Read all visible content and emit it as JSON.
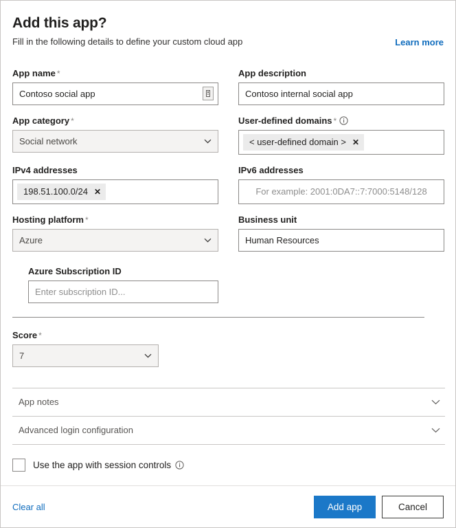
{
  "header": {
    "title": "Add this app?",
    "subtitle": "Fill in the following details to define your custom cloud app",
    "learn_more": "Learn more"
  },
  "fields": {
    "app_name": {
      "label": "App name",
      "required": "*",
      "value": "Contoso social app"
    },
    "app_description": {
      "label": "App description",
      "value": "Contoso internal social app"
    },
    "app_category": {
      "label": "App category",
      "required": "*",
      "value": "Social network"
    },
    "user_defined_domains": {
      "label": "User-defined domains",
      "required": "*",
      "chip": "< user-defined domain >",
      "chip_remove": "✕"
    },
    "ipv4_addresses": {
      "label": "IPv4 addresses",
      "chip": "198.51.100.0/24",
      "chip_remove": "✕"
    },
    "ipv6_addresses": {
      "label": "IPv6 addresses",
      "placeholder": "For example: 2001:0DA7::7:7000:5148/128"
    },
    "hosting_platform": {
      "label": "Hosting platform",
      "required": "*",
      "value": "Azure"
    },
    "business_unit": {
      "label": "Business unit",
      "value": "Human Resources"
    },
    "azure_subscription_id": {
      "label": "Azure Subscription ID",
      "placeholder": "Enter subscription ID..."
    },
    "score": {
      "label": "Score",
      "required": "*",
      "value": "7"
    }
  },
  "accordions": [
    {
      "label": "App notes"
    },
    {
      "label": "Advanced login configuration"
    }
  ],
  "session_controls": {
    "label": "Use the app with session controls",
    "checked": false
  },
  "footer": {
    "clear_all": "Clear all",
    "add_app": "Add app",
    "cancel": "Cancel"
  },
  "colors": {
    "accent_blue": "#1b78c8",
    "link_blue": "#0f6cbd",
    "chip_bg": "#ebebeb",
    "dropdown_bg": "#f4f3f2",
    "border": "#8a8886",
    "text": "#201f1e"
  }
}
